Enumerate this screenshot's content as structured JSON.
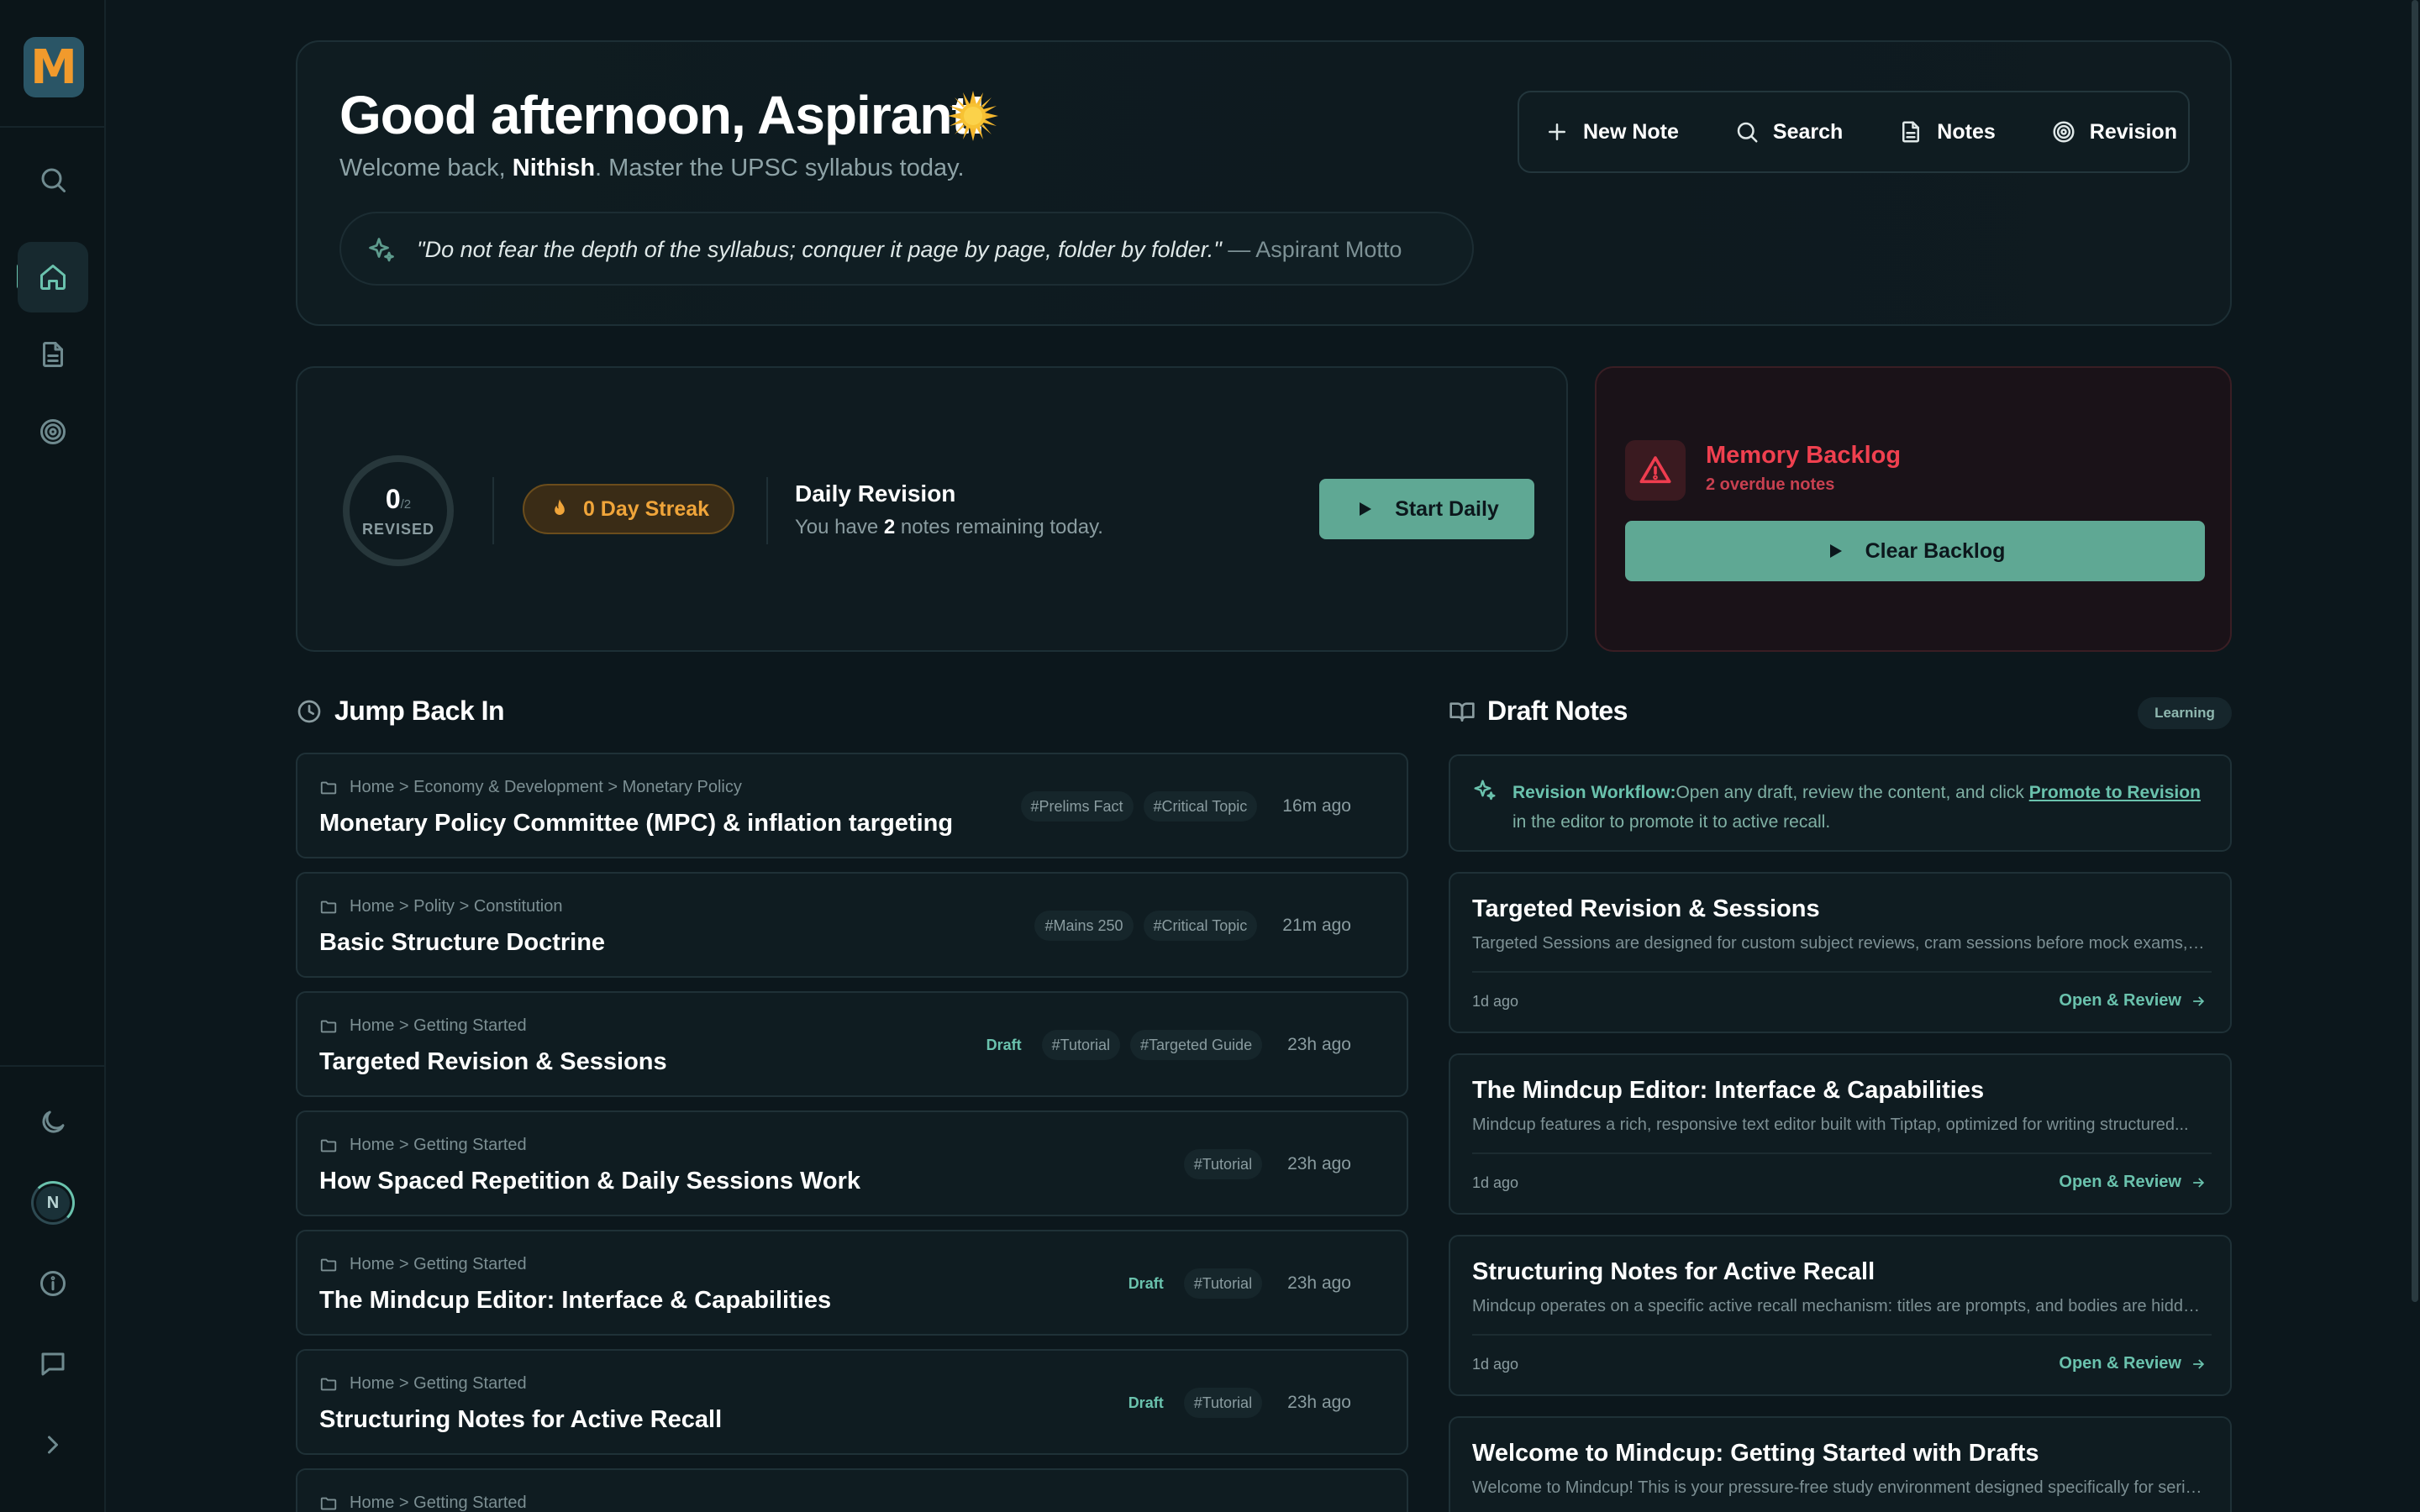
{
  "app": {
    "logo_letter": "M"
  },
  "sidebar": {
    "items": [
      {
        "name": "search",
        "icon": "search-icon"
      },
      {
        "name": "home",
        "icon": "home-icon",
        "active": true
      },
      {
        "name": "notes",
        "icon": "document-icon"
      },
      {
        "name": "revision",
        "icon": "target-icon"
      }
    ],
    "bottom": [
      {
        "name": "theme",
        "icon": "moon-icon"
      },
      {
        "name": "avatar",
        "initial": "N"
      },
      {
        "name": "info",
        "icon": "info-icon"
      },
      {
        "name": "feedback",
        "icon": "message-icon"
      },
      {
        "name": "expand",
        "icon": "chevron-right-icon"
      }
    ]
  },
  "hero": {
    "greeting": "Good afternoon, Aspirant!",
    "welcome_prefix": "Welcome back, ",
    "user_name": "Nithish",
    "welcome_suffix": ". Master the UPSC syllabus today.",
    "quote": "\"Do not fear the depth of the syllabus; conquer it page by page, folder by folder.\"",
    "quote_author": " — Aspirant Motto",
    "actions": [
      {
        "label": "New Note",
        "icon": "plus-icon"
      },
      {
        "label": "Search",
        "icon": "search-icon"
      },
      {
        "label": "Notes",
        "icon": "document-icon"
      },
      {
        "label": "Revision",
        "icon": "target-icon"
      }
    ]
  },
  "daily": {
    "revised": "0",
    "total": "/2",
    "revised_label": "REVISED",
    "streak": "0 Day Streak",
    "title": "Daily Revision",
    "sub_prefix": "You have ",
    "remaining": "2",
    "sub_suffix": " notes remaining today.",
    "button": "Start Daily"
  },
  "backlog": {
    "title": "Memory Backlog",
    "sub": "2 overdue notes",
    "button": "Clear Backlog"
  },
  "jump": {
    "heading": "Jump Back In",
    "items": [
      {
        "crumb": "Home > Economy & Development > Monetary Policy",
        "title": "Monetary Policy Committee (MPC) & inflation targeting",
        "draft": "",
        "tags": [
          "#Prelims Fact",
          "#Critical Topic"
        ],
        "time": "16m ago"
      },
      {
        "crumb": "Home > Polity > Constitution",
        "title": "Basic Structure Doctrine",
        "draft": "",
        "tags": [
          "#Mains 250",
          "#Critical Topic"
        ],
        "time": "21m ago"
      },
      {
        "crumb": "Home > Getting Started",
        "title": "Targeted Revision & Sessions",
        "draft": "Draft",
        "tags": [
          "#Tutorial",
          "#Targeted Guide"
        ],
        "time": "23h ago"
      },
      {
        "crumb": "Home > Getting Started",
        "title": "How Spaced Repetition & Daily Sessions Work",
        "draft": "",
        "tags": [
          "#Tutorial"
        ],
        "time": "23h ago"
      },
      {
        "crumb": "Home > Getting Started",
        "title": "The Mindcup Editor: Interface & Capabilities",
        "draft": "Draft",
        "tags": [
          "#Tutorial"
        ],
        "time": "23h ago"
      },
      {
        "crumb": "Home > Getting Started",
        "title": "Structuring Notes for Active Recall",
        "draft": "Draft",
        "tags": [
          "#Tutorial"
        ],
        "time": "23h ago"
      },
      {
        "crumb": "Home > Getting Started",
        "title": "",
        "draft": "",
        "tags": [],
        "time": ""
      }
    ]
  },
  "drafts": {
    "heading": "Draft Notes",
    "pill": "Learning",
    "workflow_label": "Revision Workflow:",
    "workflow_text": "Open any draft, review the content, and click ",
    "workflow_link": "Promote to Revision",
    "workflow_suffix": " in the editor to promote it to active recall.",
    "cards": [
      {
        "title": "Targeted Revision & Sessions",
        "desc": "Targeted Sessions are designed for custom subject reviews, cram sessions before mock exams, or...",
        "time": "1d ago",
        "action": "Open & Review"
      },
      {
        "title": "The Mindcup Editor: Interface & Capabilities",
        "desc": "Mindcup features a rich, responsive text editor built with Tiptap, optimized for writing structured...",
        "time": "1d ago",
        "action": "Open & Review"
      },
      {
        "title": "Structuring Notes for Active Recall",
        "desc": "Mindcup operates on a specific active recall mechanism: titles are prompts, and bodies are hidden...",
        "time": "1d ago",
        "action": "Open & Review"
      },
      {
        "title": "Welcome to Mindcup: Getting Started with Drafts",
        "desc": "Welcome to Mindcup! This is your pressure-free study environment designed specifically for seriou...",
        "time": "",
        "action": ""
      }
    ]
  },
  "colors": {
    "accent": "#6ac2ad",
    "danger": "#ef3d4f",
    "streak": "#f0a53a",
    "bg": "#0c171c"
  }
}
